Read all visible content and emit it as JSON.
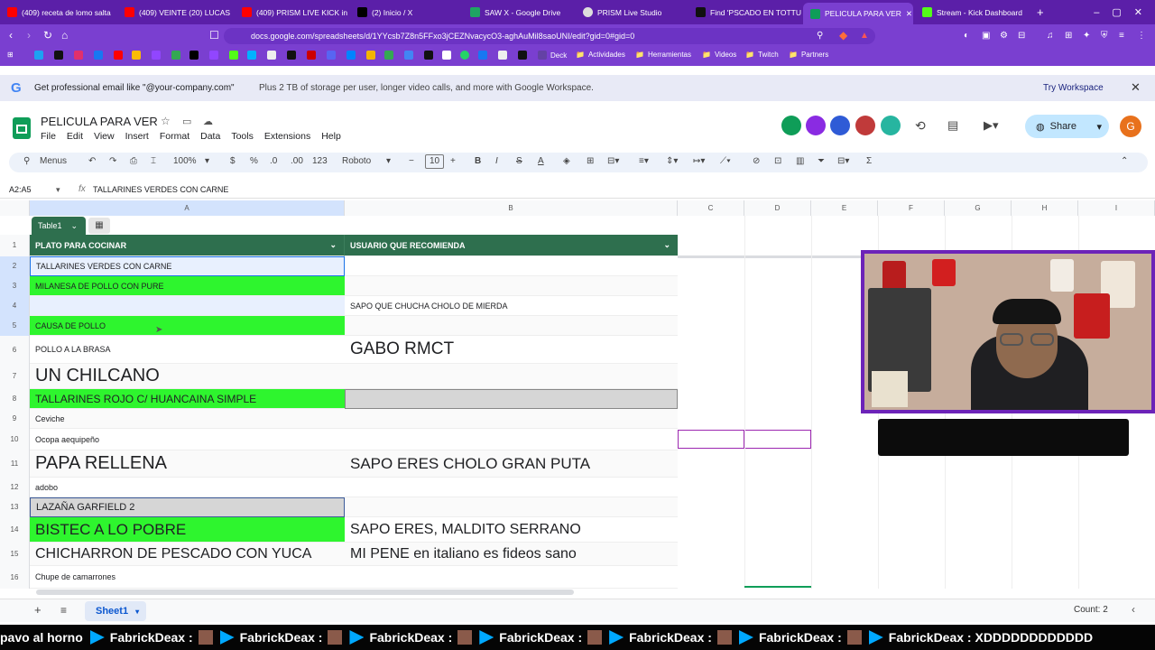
{
  "browser": {
    "tabs": [
      {
        "label": "(409) receta de lomo salta",
        "color": "#ff0000"
      },
      {
        "label": "(409) VEINTE (20) LUCAS",
        "color": "#ff0000"
      },
      {
        "label": "(409) PRISM LIVE KICK in",
        "color": "#ff0000"
      },
      {
        "label": "(2) Inicio / X",
        "color": "#000000"
      },
      {
        "label": "SAW X - Google Drive",
        "color": "#1fa463"
      },
      {
        "label": "PRISM Live Studio",
        "color": "#dddddd"
      },
      {
        "label": "Find 'PSCADO EN TOTTUS",
        "color": "#111111"
      },
      {
        "label": "PELICULA PARA VER",
        "color": "#0f9d58"
      },
      {
        "label": "Stream - Kick Dashboard",
        "color": "#53fc18"
      }
    ],
    "url": "docs.google.com/spreadsheets/d/1YYcsb7Z8n5FFxo3jCEZNvacycO3-aghAuMil8saoUNI/edit?gid=0#gid=0",
    "bookmarks": [
      "Deck",
      "Actividades",
      "Herramientas",
      "Videos",
      "Twitch",
      "Partners"
    ]
  },
  "banner": {
    "text_main": "Get professional email like \"@your-company.com\"",
    "text_sub": "Plus 2 TB of storage per user, longer video calls, and more with Google Workspace.",
    "action": "Try Workspace"
  },
  "doc": {
    "title": "PELICULA PARA VER",
    "menus": [
      "File",
      "Edit",
      "View",
      "Insert",
      "Format",
      "Data",
      "Tools",
      "Extensions",
      "Help"
    ],
    "share_label": "Share",
    "avatar_letter": "G"
  },
  "toolbar": {
    "search": "Menus",
    "zoom": "100%",
    "currency": "$",
    "percent": "%",
    "dec_dec": ".0",
    "dec_inc": ".00",
    "number_format": "123",
    "font": "Roboto",
    "font_size": "10"
  },
  "formula": {
    "namebox": "A2:A5",
    "fx": "fx",
    "content": "TALLARINES VERDES CON CARNE"
  },
  "grid": {
    "columns": [
      "A",
      "B",
      "C",
      "D",
      "E",
      "F",
      "G",
      "H",
      "I"
    ],
    "table_name": "Table1",
    "headers": [
      "PLATO PARA COCINAR",
      "USUARIO QUE RECOMIENDA"
    ],
    "rows": [
      {
        "num": "1"
      },
      {
        "num": "2",
        "a": "TALLARINES VERDES CON CARNE",
        "b": ""
      },
      {
        "num": "3",
        "a": "MILANESA DE POLLO CON PURE",
        "b": ""
      },
      {
        "num": "4",
        "a": "",
        "b": "SAPO QUE CHUCHA CHOLO DE MIERDA"
      },
      {
        "num": "5",
        "a": "CAUSA DE POLLO",
        "b": ""
      },
      {
        "num": "6",
        "a": "POLLO A LA BRASA",
        "b": "GABO RMCT"
      },
      {
        "num": "7",
        "a": "UN CHILCANO",
        "b": ""
      },
      {
        "num": "8",
        "a": "TALLARINES ROJO C/ HUANCAINA SIMPLE",
        "b": ""
      },
      {
        "num": "9",
        "a": "Ceviche",
        "b": ""
      },
      {
        "num": "10",
        "a": "Ocopa aequipeño",
        "b": ""
      },
      {
        "num": "11",
        "a": "PAPA RELLENA",
        "b": "SAPO ERES CHOLO GRAN PUTA"
      },
      {
        "num": "12",
        "a": "adobo",
        "b": ""
      },
      {
        "num": "13",
        "a": "LAZAÑA GARFIELD 2",
        "b": ""
      },
      {
        "num": "14",
        "a": "BISTEC A LO POBRE",
        "b": "SAPO ERES, MALDITO SERRANO"
      },
      {
        "num": "15",
        "a": "CHICHARRON DE PESCADO CON YUCA",
        "b": "MI PENE en italiano es fideos sano"
      },
      {
        "num": "16",
        "a": "Chupe de camarrones",
        "b": ""
      }
    ]
  },
  "sheetbar": {
    "tab": "Sheet1",
    "status": "Count: 2"
  },
  "ticker": {
    "start": "pavo al horno",
    "items": [
      "FabrickDeax :",
      "FabrickDeax :",
      "FabrickDeax :",
      "FabrickDeax :",
      "FabrickDeax :",
      "FabrickDeax :",
      "FabrickDeax :"
    ],
    "end": "FabrickDeax : XDDDDDDDDDDDD"
  },
  "colors": {
    "browser": "#5b1fa8",
    "table_header": "#2e6f4e",
    "highlight_green": "#2ef52e"
  }
}
